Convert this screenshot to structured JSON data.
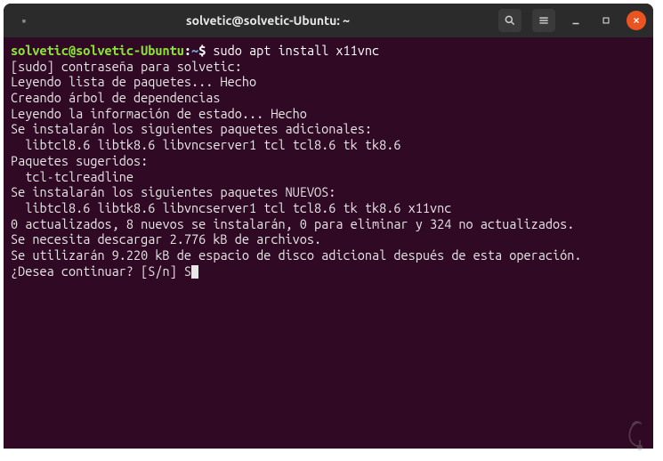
{
  "titlebar": {
    "title": "solvetic@solvetic-Ubuntu: ~"
  },
  "prompt": {
    "userhost": "solvetic@solvetic-Ubuntu",
    "sep": ":",
    "path": "~",
    "dollar": "$"
  },
  "command": "sudo apt install x11vnc",
  "output": {
    "l1": "[sudo] contraseña para solvetic:",
    "l2": "Leyendo lista de paquetes... Hecho",
    "l3": "Creando árbol de dependencias",
    "l4": "Leyendo la información de estado... Hecho",
    "l5": "Se instalarán los siguientes paquetes adicionales:",
    "l6": "  libtcl8.6 libtk8.6 libvncserver1 tcl tcl8.6 tk tk8.6",
    "l7": "Paquetes sugeridos:",
    "l8": "  tcl-tclreadline",
    "l9": "Se instalarán los siguientes paquetes NUEVOS:",
    "l10": "  libtcl8.6 libtk8.6 libvncserver1 tcl tcl8.6 tk tk8.6 x11vnc",
    "l11": "0 actualizados, 8 nuevos se instalarán, 0 para eliminar y 324 no actualizados.",
    "l12": "Se necesita descargar 2.776 kB de archivos.",
    "l13": "Se utilizarán 9.220 kB de espacio de disco adicional después de esta operación.",
    "l14": "¿Desea continuar? [S/n] S"
  }
}
